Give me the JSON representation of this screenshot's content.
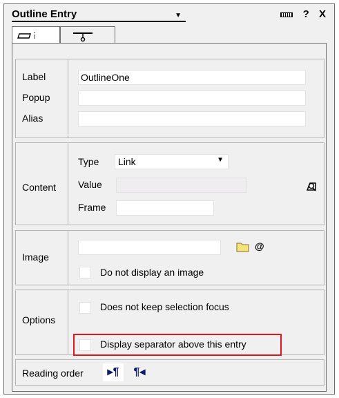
{
  "title": "Outline Entry",
  "title_icons": {
    "grip": "grip-icon",
    "help": "?",
    "close": "X"
  },
  "tabs": [
    {
      "name": "entry-tab",
      "icon": "page-info-icon",
      "active": true
    },
    {
      "name": "separator-tab",
      "icon": "pin-icon",
      "active": false
    }
  ],
  "naming": {
    "label_label": "Label",
    "label_value": "OutlineOne",
    "popup_label": "Popup",
    "popup_value": "",
    "alias_label": "Alias",
    "alias_value": ""
  },
  "content": {
    "section_label": "Content",
    "type_label": "Type",
    "type_value": "Link",
    "value_label": "Value",
    "value_value": "",
    "frame_label": "Frame",
    "frame_value": "",
    "picker_icon": "link-picker-icon"
  },
  "image": {
    "section_label": "Image",
    "value": "",
    "folder_icon": "folder-icon",
    "at_icon": "@",
    "no_image_label": "Do not display an image",
    "no_image_checked": false
  },
  "options": {
    "section_label": "Options",
    "no_focus_label": "Does not keep selection focus",
    "no_focus_checked": false,
    "separator_label": "Display separator above this entry",
    "separator_checked": false
  },
  "reading_order": {
    "label": "Reading order",
    "ltr_icon": "▸¶",
    "rtl_icon": "¶◂"
  }
}
